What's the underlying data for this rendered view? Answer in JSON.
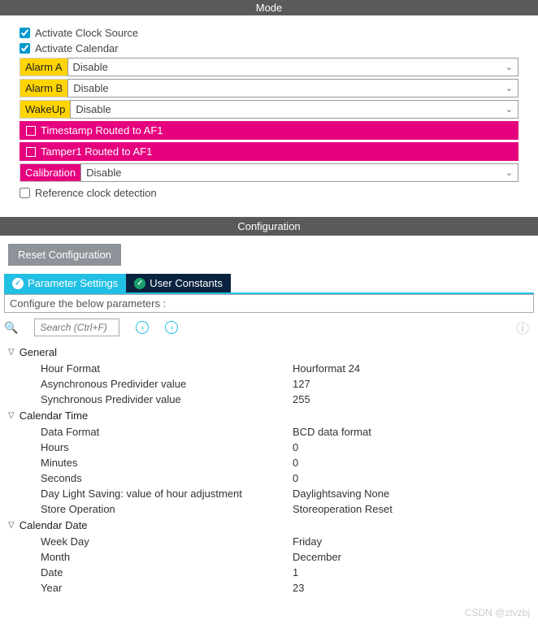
{
  "headers": {
    "mode": "Mode",
    "configuration": "Configuration"
  },
  "mode": {
    "activate_clock": "Activate Clock Source",
    "activate_calendar": "Activate Calendar",
    "alarmA": {
      "label": "Alarm A",
      "value": "Disable"
    },
    "alarmB": {
      "label": "Alarm B",
      "value": "Disable"
    },
    "wakeup": {
      "label": "WakeUp",
      "value": "Disable"
    },
    "timestamp": "Timestamp Routed to AF1",
    "tamper1": "Tamper1 Routed to AF1",
    "calibration": {
      "label": "Calibration",
      "value": "Disable"
    },
    "ref_clock": "Reference clock detection"
  },
  "reset_btn": "Reset Configuration",
  "tabs": {
    "param": "Parameter Settings",
    "user": "User Constants"
  },
  "config_header": "Configure the below parameters :",
  "search": {
    "placeholder": "Search (Ctrl+F)"
  },
  "groups": {
    "general": {
      "title": "General",
      "hour_format": {
        "label": "Hour Format",
        "value": "Hourformat 24"
      },
      "async_pre": {
        "label": "Asynchronous Predivider value",
        "value": "127"
      },
      "sync_pre": {
        "label": "Synchronous Predivider value",
        "value": "255"
      }
    },
    "calendar_time": {
      "title": "Calendar Time",
      "data_format": {
        "label": "Data Format",
        "value": "BCD data format"
      },
      "hours": {
        "label": "Hours",
        "value": "0"
      },
      "minutes": {
        "label": "Minutes",
        "value": "0"
      },
      "seconds": {
        "label": "Seconds",
        "value": "0"
      },
      "daylight": {
        "label": "Day Light Saving: value of hour adjustment",
        "value": "Daylightsaving None"
      },
      "store": {
        "label": "Store Operation",
        "value": "Storeoperation Reset"
      }
    },
    "calendar_date": {
      "title": "Calendar Date",
      "weekday": {
        "label": "Week Day",
        "value": "Friday"
      },
      "month": {
        "label": "Month",
        "value": "December"
      },
      "date": {
        "label": "Date",
        "value": "1"
      },
      "year": {
        "label": "Year",
        "value": "23"
      }
    }
  },
  "watermark": "CSDN @ztvzbj"
}
